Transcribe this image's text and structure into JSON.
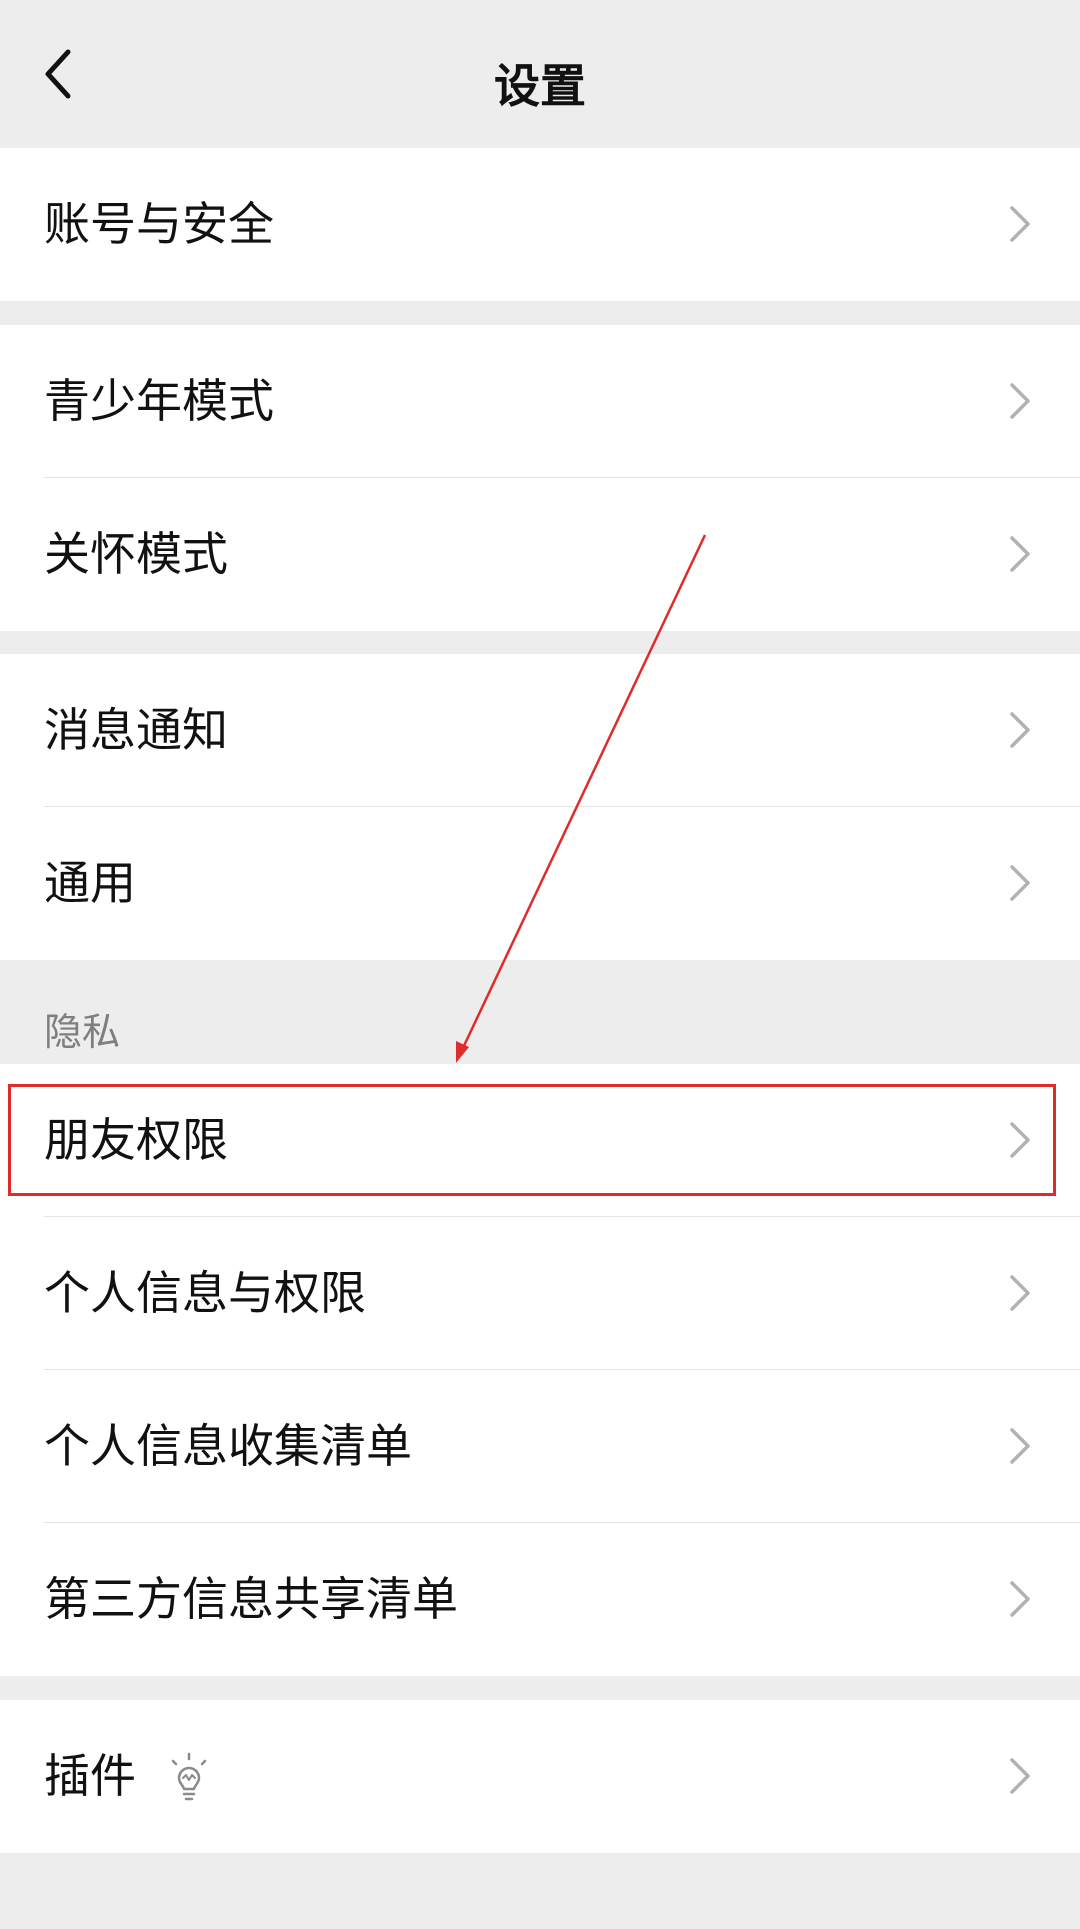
{
  "header": {
    "title": "设置",
    "back_icon": "chevron-left-icon"
  },
  "groups": [
    {
      "items": [
        {
          "label": "账号与安全"
        }
      ]
    },
    {
      "items": [
        {
          "label": "青少年模式"
        },
        {
          "label": "关怀模式"
        }
      ]
    },
    {
      "items": [
        {
          "label": "消息通知"
        },
        {
          "label": "通用"
        }
      ]
    },
    {
      "section_title": "隐私",
      "items": [
        {
          "label": "朋友权限",
          "highlighted": true
        },
        {
          "label": "个人信息与权限"
        },
        {
          "label": "个人信息收集清单"
        },
        {
          "label": "第三方信息共享清单"
        }
      ]
    },
    {
      "items": [
        {
          "label": "插件",
          "icon": "lightbulb-icon"
        }
      ]
    }
  ],
  "colors": {
    "background": "#ededed",
    "row_background": "#ffffff",
    "text": "#111111",
    "section_text": "#7f7f7f",
    "chevron": "#b2b2b2",
    "annotation": "#e02b2b"
  }
}
